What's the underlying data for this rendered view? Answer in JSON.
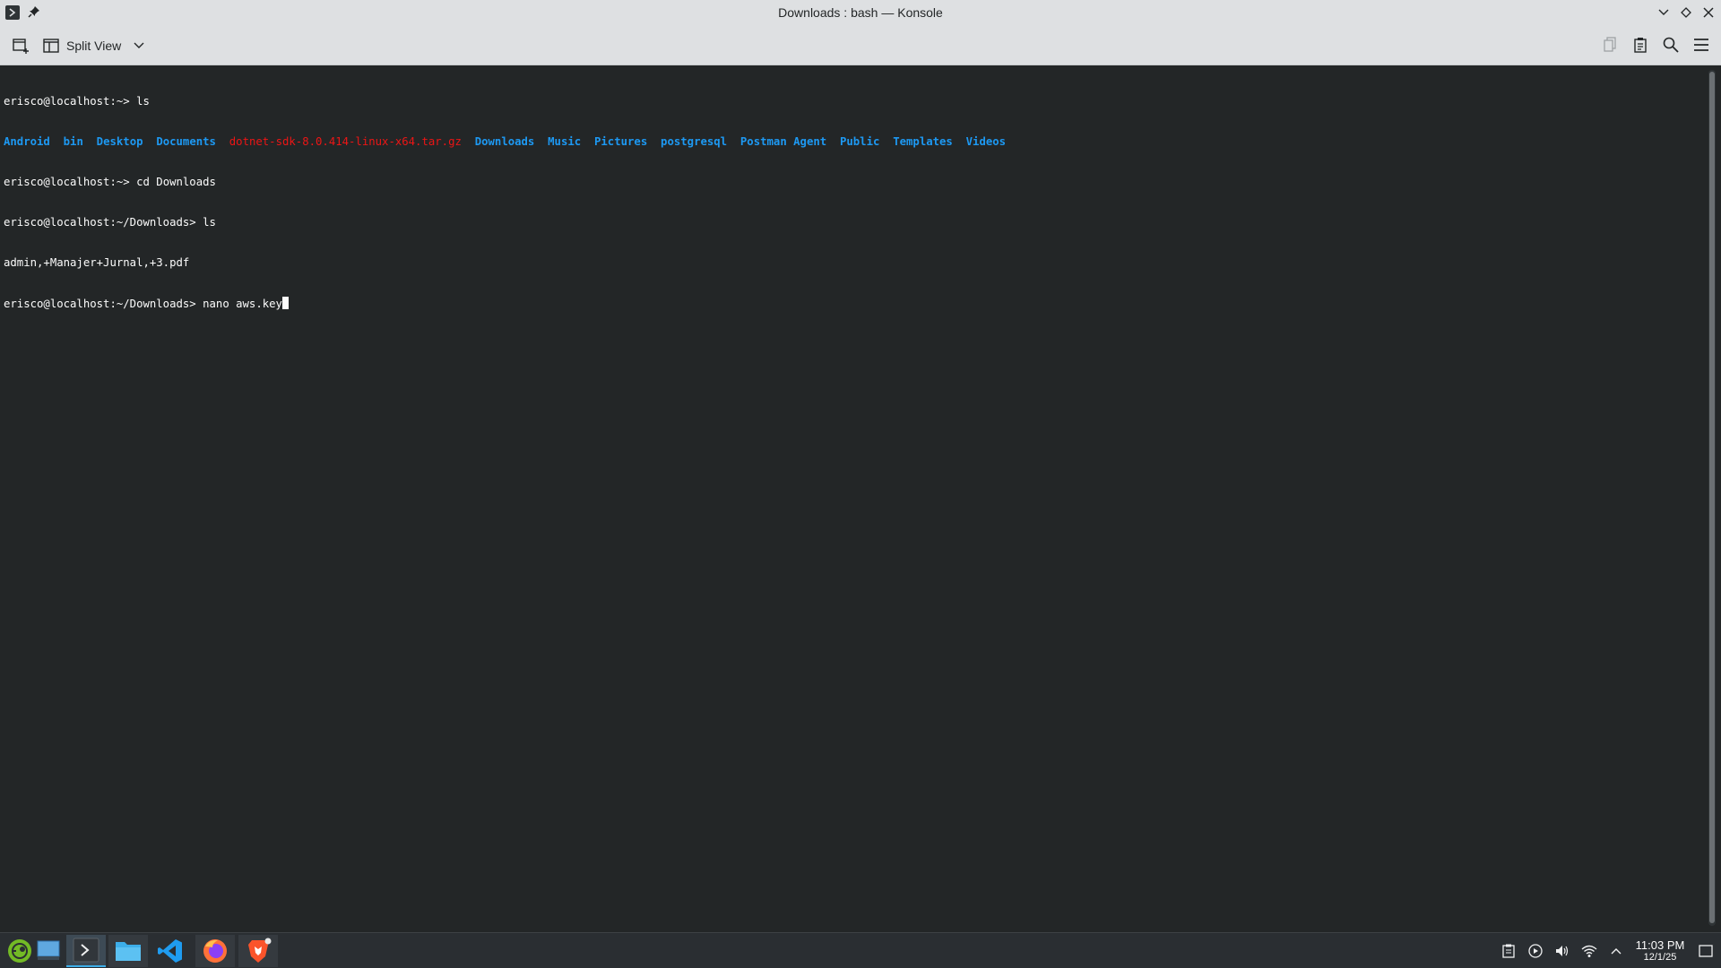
{
  "window": {
    "title": "Downloads : bash — Konsole"
  },
  "toolbar": {
    "split_view_label": "Split View"
  },
  "terminal": {
    "lines": [
      {
        "prompt": "erisco@localhost:~> ",
        "command": "ls"
      },
      {
        "ls_items": [
          {
            "name": "Android",
            "kind": "dir"
          },
          {
            "name": "bin",
            "kind": "dir"
          },
          {
            "name": "Desktop",
            "kind": "dir"
          },
          {
            "name": "Documents",
            "kind": "dir"
          },
          {
            "name": "dotnet-sdk-8.0.414-linux-x64.tar.gz",
            "kind": "archive"
          },
          {
            "name": "Downloads",
            "kind": "dir"
          },
          {
            "name": "Music",
            "kind": "dir"
          },
          {
            "name": "Pictures",
            "kind": "dir"
          },
          {
            "name": "postgresql",
            "kind": "dir"
          },
          {
            "name": "Postman Agent",
            "kind": "dir"
          },
          {
            "name": "Public",
            "kind": "dir"
          },
          {
            "name": "Templates",
            "kind": "dir"
          },
          {
            "name": "Videos",
            "kind": "dir"
          }
        ]
      },
      {
        "prompt": "erisco@localhost:~> ",
        "command": "cd Downloads"
      },
      {
        "prompt": "erisco@localhost:~/Downloads> ",
        "command": "ls"
      },
      {
        "output": "admin,+Manajer+Jurnal,+3.pdf"
      },
      {
        "prompt": "erisco@localhost:~/Downloads> ",
        "command": "nano aws.key"
      }
    ],
    "colors": {
      "background": "#232627",
      "foreground": "#fcfcfc",
      "directory": "#1d99f3",
      "archive": "#ed1515"
    }
  },
  "taskbar": {
    "apps": [
      {
        "name": "Application Launcher",
        "icon": "opensuse-launcher-icon"
      },
      {
        "name": "Desktop",
        "icon": "desktop-icon"
      },
      {
        "name": "Konsole",
        "icon": "konsole-icon",
        "active": true
      },
      {
        "name": "Dolphin",
        "icon": "folder-icon"
      },
      {
        "name": "Visual Studio Code",
        "icon": "vscode-icon"
      },
      {
        "name": "Firefox",
        "icon": "firefox-icon"
      },
      {
        "name": "Brave",
        "icon": "brave-icon"
      }
    ],
    "clock": {
      "time": "11:03 PM",
      "date": "12/1/25"
    }
  }
}
